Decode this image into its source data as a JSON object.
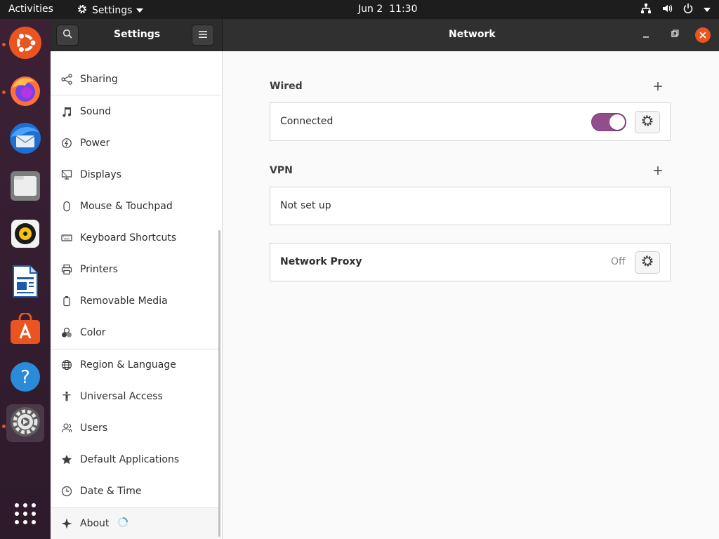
{
  "topbar": {
    "activities": "Activities",
    "app_menu": "Settings",
    "clock": "Jun 2  11:30"
  },
  "dock": {
    "items": [
      {
        "name": "ubuntu-logo",
        "running": true
      },
      {
        "name": "firefox",
        "running": true
      },
      {
        "name": "thunderbird",
        "running": false
      },
      {
        "name": "files",
        "running": false
      },
      {
        "name": "rhythmbox",
        "running": false
      },
      {
        "name": "libreoffice-writer",
        "running": false
      },
      {
        "name": "ubuntu-software",
        "running": false
      },
      {
        "name": "help",
        "running": false
      },
      {
        "name": "settings",
        "running": true,
        "active": true
      },
      {
        "name": "show-applications",
        "running": false
      }
    ]
  },
  "header": {
    "sidebar_title": "Settings",
    "page_title": "Network"
  },
  "sidebar": {
    "items": [
      {
        "label": "Sharing",
        "icon": "share-icon"
      },
      {
        "label": "Sound",
        "icon": "music-note-icon"
      },
      {
        "label": "Power",
        "icon": "power-icon"
      },
      {
        "label": "Displays",
        "icon": "display-icon"
      },
      {
        "label": "Mouse & Touchpad",
        "icon": "mouse-icon"
      },
      {
        "label": "Keyboard Shortcuts",
        "icon": "keyboard-icon"
      },
      {
        "label": "Printers",
        "icon": "printer-icon"
      },
      {
        "label": "Removable Media",
        "icon": "removable-media-icon"
      },
      {
        "label": "Color",
        "icon": "color-icon"
      },
      {
        "label": "Region & Language",
        "icon": "globe-icon"
      },
      {
        "label": "Universal Access",
        "icon": "accessibility-icon"
      },
      {
        "label": "Users",
        "icon": "users-icon"
      },
      {
        "label": "Default Applications",
        "icon": "star-icon"
      },
      {
        "label": "Date & Time",
        "icon": "clock-icon"
      },
      {
        "label": "About",
        "icon": "sparkle-icon"
      }
    ]
  },
  "network": {
    "wired": {
      "title": "Wired",
      "status": "Connected",
      "enabled": true
    },
    "vpn": {
      "title": "VPN",
      "status": "Not set up"
    },
    "proxy": {
      "title": "Network Proxy",
      "state": "Off"
    }
  },
  "colors": {
    "accent_toggle": "#924d8b",
    "ubuntu_orange": "#e95420",
    "topbar": "#1d1d1d",
    "headerbar": "#303030"
  }
}
